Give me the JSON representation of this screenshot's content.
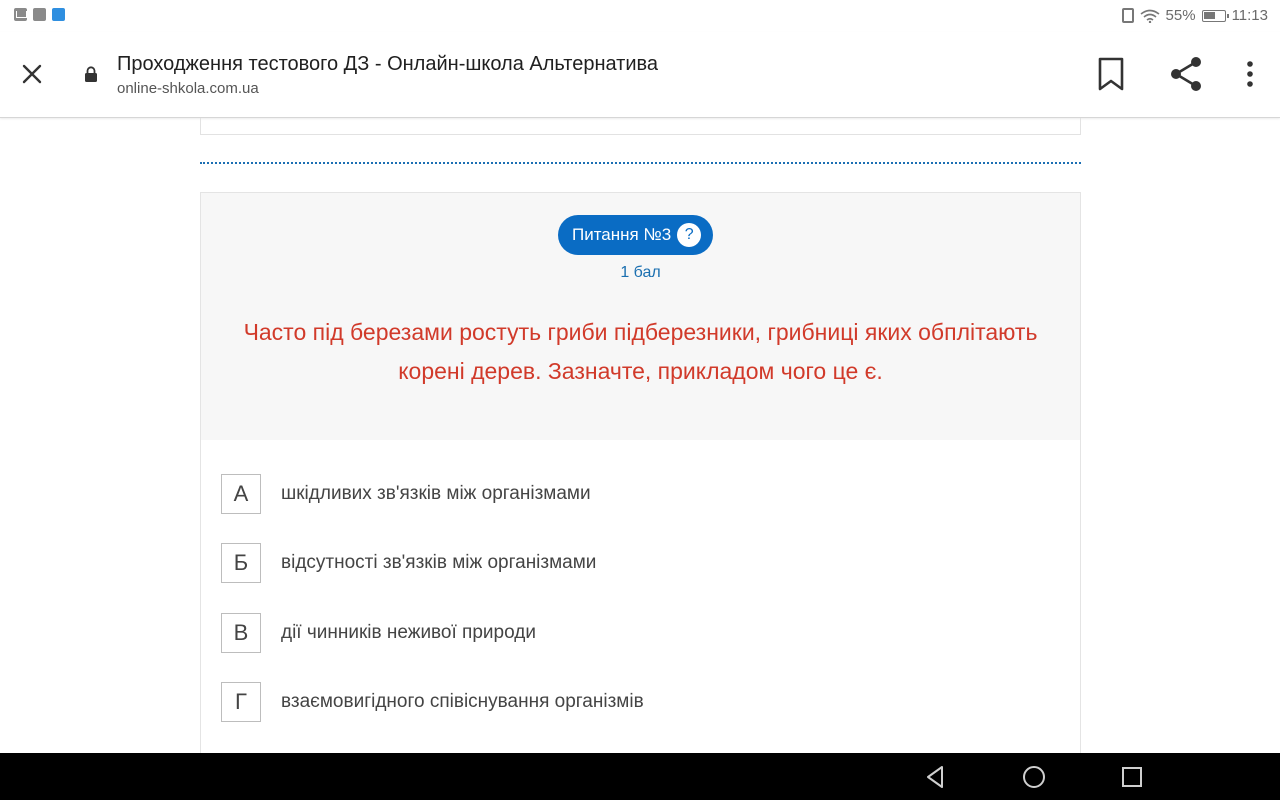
{
  "status_bar": {
    "battery": "55%",
    "time": "11:13",
    "left_icons": [
      "mail-icon",
      "notification-icon",
      "app-icon"
    ]
  },
  "header": {
    "title": "Проходження тестового ДЗ - Онлайн-школа Альтернатива",
    "url": "online-shkola.com.ua",
    "icons": [
      "close-icon",
      "lock-icon",
      "bookmark-icon",
      "share-icon",
      "more-icon"
    ]
  },
  "question": {
    "label": "Питання №3",
    "help": "?",
    "points": "1 бал",
    "text": "Часто під березами ростуть гриби підберезники, грибниці яких обплітають корені дерев. Зазначте, прикладом чого це є.",
    "answers": [
      {
        "letter": "А",
        "text": "шкідливих зв'язків між організмами"
      },
      {
        "letter": "Б",
        "text": "відсутності зв'язків між організмами"
      },
      {
        "letter": "В",
        "text": "дії чинників неживої природи"
      },
      {
        "letter": "Г",
        "text": "взаємовигідного співіснування організмів"
      }
    ]
  },
  "colors": {
    "accent": "#0a6cc4",
    "question_text": "#d13a2a",
    "points_text": "#1a6fb0"
  },
  "nav_bar": {
    "icons": [
      "back-icon",
      "home-icon",
      "recents-icon"
    ]
  }
}
